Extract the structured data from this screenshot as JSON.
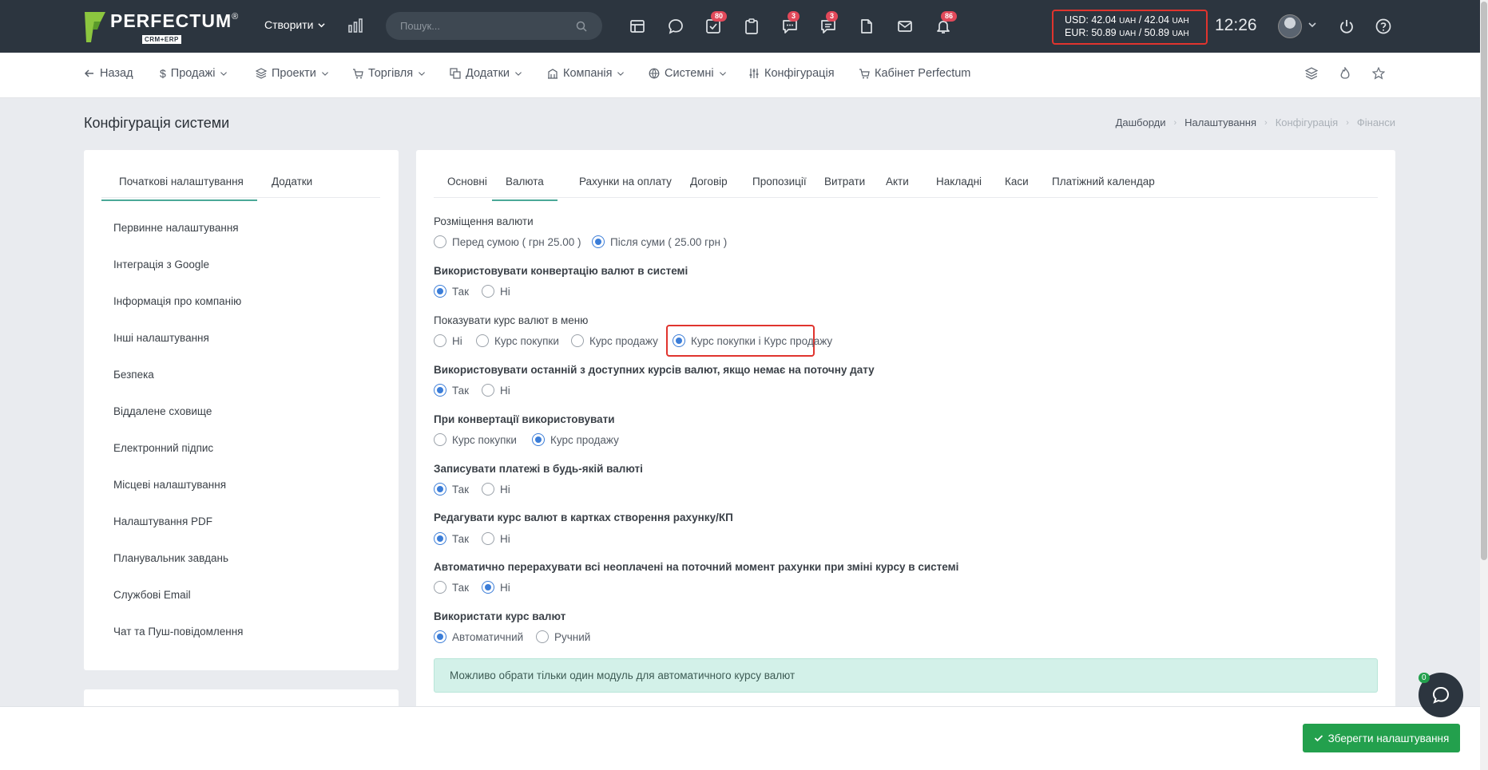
{
  "brand": {
    "name": "PERFECTUM",
    "reg": "®",
    "sub": "CRM+ERP"
  },
  "topbar": {
    "create_label": "Створити",
    "search_placeholder": "Пошук...",
    "badges": {
      "tasks": "80",
      "chat": "3",
      "messages": "3",
      "notifications": "86"
    },
    "rates": {
      "usd": "USD: 42.04",
      "usd_sell": "/ 42.04",
      "eur": "EUR: 50.89",
      "eur_sell": "/ 50.89",
      "unit": "UAH"
    },
    "clock": "12:26"
  },
  "nav": {
    "back": "Назад",
    "sales": "Продажі",
    "projects": "Проекти",
    "trade": "Торгівля",
    "addons": "Додатки",
    "company": "Компанія",
    "system": "Системні",
    "config": "Конфігурація",
    "cabinet": "Кабінет Perfectum"
  },
  "page": {
    "title": "Конфігурація системи",
    "breadcrumbs": [
      "Дашборди",
      "Налаштування",
      "Конфігурація",
      "Фінанси"
    ]
  },
  "left": {
    "tabs": [
      "Початкові налаштування",
      "Додатки"
    ],
    "menu": [
      "Первинне налаштування",
      "Інтеграція з Google",
      "Інформація про компанію",
      "Інші налаштування",
      "Безпека",
      "Віддалене сховище",
      "Електронний підпис",
      "Місцеві налаштування",
      "Налаштування PDF",
      "Планувальник завдань",
      "Службові Email",
      "Чат та Пуш-повідомлення"
    ]
  },
  "main": {
    "tabs": [
      "Основні",
      "Валюта",
      "Рахунки на оплату",
      "Договір",
      "Пропозиції",
      "Витрати",
      "Акти",
      "Накладні",
      "Каси",
      "Платіжний календар"
    ],
    "active_tab": "Валюта",
    "settings": [
      {
        "label": "Розміщення валюти",
        "options": [
          "Перед сумою ( грн 25.00 )",
          "Після суми ( 25.00 грн )"
        ],
        "selected": 1
      },
      {
        "label": "Використовувати конвертацію валют в системі",
        "options": [
          "Так",
          "Ні"
        ],
        "selected": 0
      },
      {
        "label": "Показувати курс валют в меню",
        "options": [
          "Ні",
          "Курс покупки",
          "Курс продажу",
          "Курс покупки і Курс продажу"
        ],
        "selected": 3
      },
      {
        "label": "Використовувати останній з доступних курсів валют, якщо немає на поточну дату",
        "options": [
          "Так",
          "Ні"
        ],
        "selected": 0
      },
      {
        "label": "При конвертації використовувати",
        "options": [
          "Курс покупки",
          "Курс продажу"
        ],
        "selected": 1
      },
      {
        "label": "Записувати платежі в будь-якій валюті",
        "options": [
          "Так",
          "Ні"
        ],
        "selected": 0
      },
      {
        "label": "Редагувати курс валют в картках створення рахунку/КП",
        "options": [
          "Так",
          "Ні"
        ],
        "selected": 0
      },
      {
        "label": "Автоматично перерахувати всі неоплачені на поточний момент рахунки при зміні курсу в системі",
        "options": [
          "Так",
          "Ні"
        ],
        "selected": 1
      },
      {
        "label": "Використати курс валют",
        "options": [
          "Автоматичний",
          "Ручний"
        ],
        "selected": 0
      }
    ],
    "alert": "Можливо обрати тільки один модуль для автоматичного курсу валют"
  },
  "footer": {
    "save_label": "Зберегти налаштування",
    "chat_count": "0"
  }
}
